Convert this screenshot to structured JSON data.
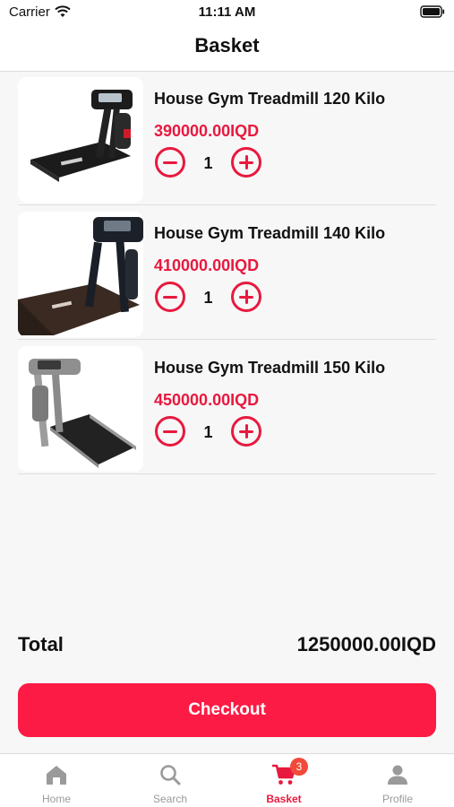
{
  "status_bar": {
    "carrier": "Carrier",
    "time": "11:11 AM"
  },
  "header": {
    "title": "Basket"
  },
  "items": [
    {
      "name": "House Gym Treadmill 120 Kilo",
      "price": "390000.00IQD",
      "quantity": "1",
      "image_icon": "treadmill-image"
    },
    {
      "name": "House Gym Treadmill 140 Kilo",
      "price": "410000.00IQD",
      "quantity": "1",
      "image_icon": "treadmill-image"
    },
    {
      "name": "House Gym Treadmill 150 Kilo",
      "price": "450000.00IQD",
      "quantity": "1",
      "image_icon": "treadmill-image"
    }
  ],
  "summary": {
    "total_label": "Total",
    "total_value": "1250000.00IQD"
  },
  "checkout": {
    "label": "Checkout"
  },
  "tabbar": {
    "tabs": [
      {
        "label": "Home",
        "icon": "home-icon",
        "active": false
      },
      {
        "label": "Search",
        "icon": "search-icon",
        "active": false
      },
      {
        "label": "Basket",
        "icon": "cart-icon",
        "active": true,
        "badge": "3"
      },
      {
        "label": "Profile",
        "icon": "profile-icon",
        "active": false
      }
    ]
  },
  "colors": {
    "accent": "#fc1b45",
    "price": "#e8193f",
    "badge": "#f24a3a",
    "inactive_tab": "#9a9a9a"
  }
}
